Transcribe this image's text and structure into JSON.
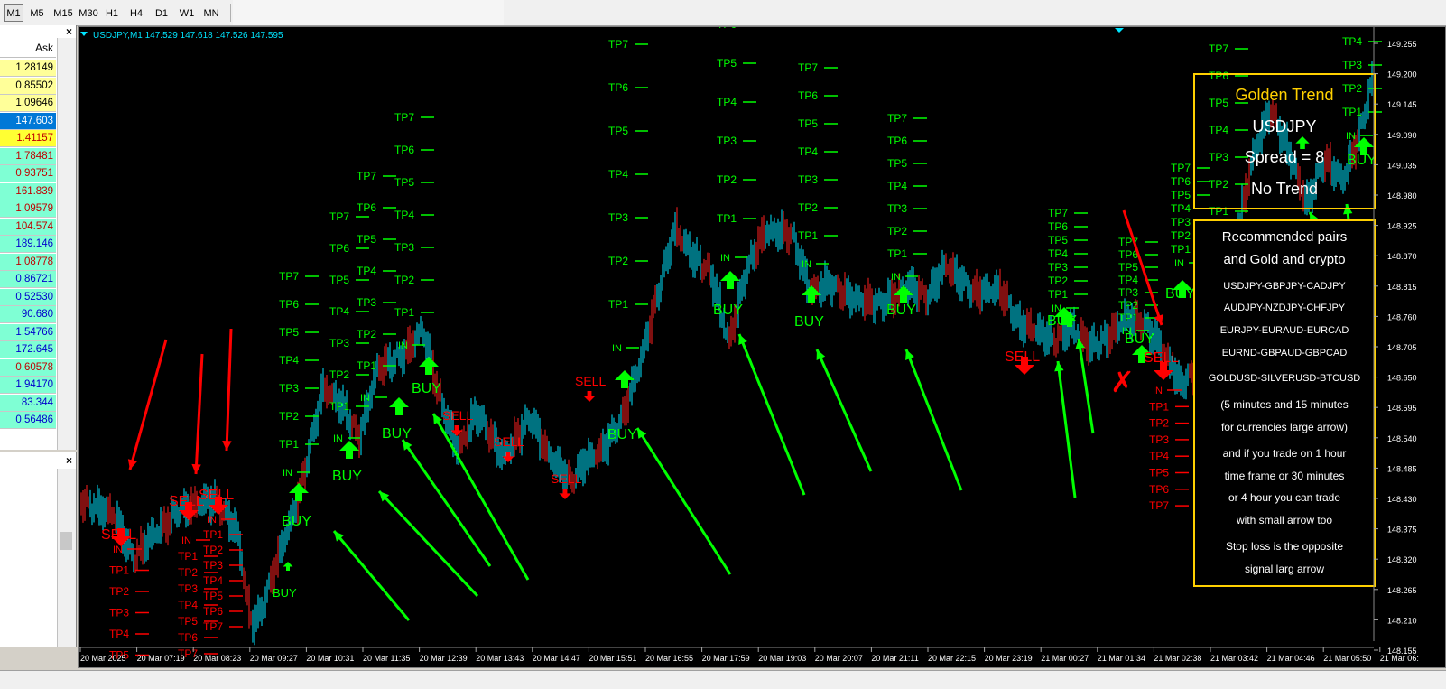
{
  "timeframes": [
    "M1",
    "M5",
    "M15",
    "M30",
    "H1",
    "H4",
    "D1",
    "W1",
    "MN"
  ],
  "active_timeframe": "M1",
  "market_watch": {
    "header": "Ask",
    "rows": [
      {
        "ask": "1.28149",
        "bg": "#ffff99",
        "fg": "#000000"
      },
      {
        "ask": "0.85502",
        "bg": "#ffff99",
        "fg": "#000000"
      },
      {
        "ask": "1.09646",
        "bg": "#ffff99",
        "fg": "#000000"
      },
      {
        "ask": "147.603",
        "bg": "#0078d7",
        "fg": "#ffffff"
      },
      {
        "ask": "1.41157",
        "bg": "#ffff33",
        "fg": "#c00000"
      },
      {
        "ask": "1.78481",
        "bg": "#7fffd4",
        "fg": "#c00000"
      },
      {
        "ask": "0.93751",
        "bg": "#7fffd4",
        "fg": "#c00000"
      },
      {
        "ask": "161.839",
        "bg": "#7fffd4",
        "fg": "#c00000"
      },
      {
        "ask": "1.09579",
        "bg": "#7fffd4",
        "fg": "#c00000"
      },
      {
        "ask": "104.574",
        "bg": "#7fffd4",
        "fg": "#c00000"
      },
      {
        "ask": "189.146",
        "bg": "#7fffd4",
        "fg": "#0000cc"
      },
      {
        "ask": "1.08778",
        "bg": "#7fffd4",
        "fg": "#c00000"
      },
      {
        "ask": "0.86721",
        "bg": "#7fffd4",
        "fg": "#0000cc"
      },
      {
        "ask": "0.52530",
        "bg": "#7fffd4",
        "fg": "#0000cc"
      },
      {
        "ask": "90.680",
        "bg": "#7fffd4",
        "fg": "#0000cc"
      },
      {
        "ask": "1.54766",
        "bg": "#7fffd4",
        "fg": "#0000cc"
      },
      {
        "ask": "172.645",
        "bg": "#7fffd4",
        "fg": "#0000cc"
      },
      {
        "ask": "0.60578",
        "bg": "#7fffd4",
        "fg": "#c00000"
      },
      {
        "ask": "1.94170",
        "bg": "#7fffd4",
        "fg": "#0000cc"
      },
      {
        "ask": "83.344",
        "bg": "#7fffd4",
        "fg": "#0000cc"
      },
      {
        "ask": "0.56486",
        "bg": "#7fffd4",
        "fg": "#0000cc"
      }
    ]
  },
  "chart": {
    "header": "USDJPY,M1  147.529 147.618 147.526 147.595",
    "price_axis": [
      "149.255",
      "149.200",
      "149.145",
      "149.090",
      "149.035",
      "148.980",
      "148.925",
      "148.870",
      "148.815",
      "148.760",
      "148.705",
      "148.650",
      "148.595",
      "148.540",
      "148.485",
      "148.430",
      "148.375",
      "148.320",
      "148.265",
      "148.210",
      "148.155"
    ],
    "time_axis": [
      "20 Mar 2025",
      "20 Mar 07:19",
      "20 Mar 08:23",
      "20 Mar 09:27",
      "20 Mar 10:31",
      "20 Mar 11:35",
      "20 Mar 12:39",
      "20 Mar 13:43",
      "20 Mar 14:47",
      "20 Mar 15:51",
      "20 Mar 16:55",
      "20 Mar 17:59",
      "20 Mar 19:03",
      "20 Mar 20:07",
      "20 Mar 21:11",
      "20 Mar 22:15",
      "20 Mar 23:19",
      "21 Mar 00:27",
      "21 Mar 01:34",
      "21 Mar 02:38",
      "21 Mar 03:42",
      "21 Mar 04:46",
      "21 Mar 05:50",
      "21 Mar 06:"
    ],
    "colors": {
      "buy": "#00ff00",
      "sell": "#ff0000",
      "candle": "#00e5ff",
      "bear": "#ff2020",
      "box": "#ffd000"
    }
  },
  "labels": {
    "buy": "BUY",
    "sell": "SELL",
    "in": "IN",
    "tp": [
      "TP1",
      "TP2",
      "TP3",
      "TP4",
      "TP5",
      "TP6",
      "TP7"
    ]
  },
  "info_top": {
    "title": "Golden Trend",
    "pair": "USDJPY",
    "spread": "Spread = 8",
    "trend": "No Trend"
  },
  "info_bottom": {
    "lines": [
      "Recommended pairs",
      "and Gold and crypto",
      "USDJPY-GBPJPY-CADJPY",
      "AUDJPY-NZDJPY-CHFJPY",
      "EURJPY-EURAUD-EURCAD",
      "EURND-GBPAUD-GBPCAD",
      "GOLDUSD-SILVERUSD-BTCUSD",
      "(5 minutes and 15 minutes",
      "for currencies large arrow)",
      "and if you trade on 1 hour",
      "time frame or 30 minutes",
      "or 4 hour you can trade",
      "with small arrow too",
      "Stop loss is the opposite",
      "signal larg arrow"
    ]
  }
}
